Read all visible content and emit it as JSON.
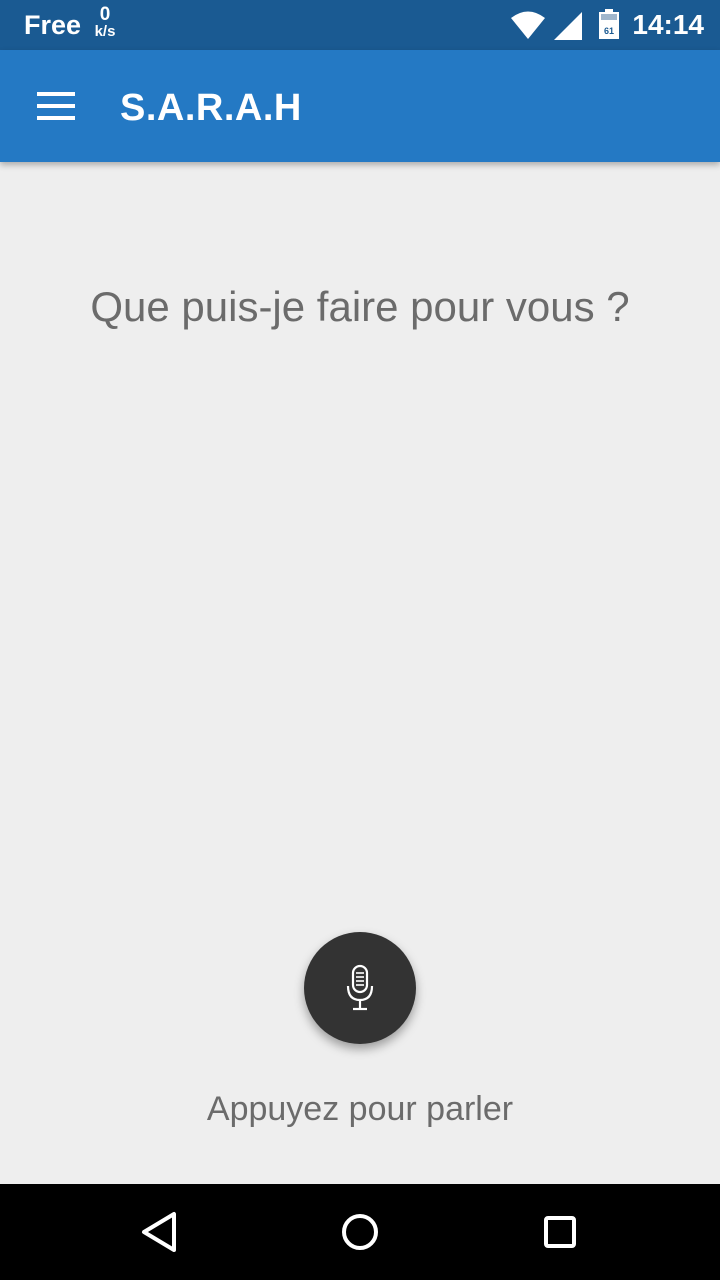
{
  "status_bar": {
    "carrier": "Free",
    "net_speed_value": "0",
    "net_speed_unit": "k/s",
    "battery_level": "61",
    "time": "14:14",
    "icons": [
      "wifi-icon",
      "cell-signal-icon",
      "battery-icon"
    ]
  },
  "app_bar": {
    "title": "S.A.R.A.H",
    "menu_icon": "hamburger-menu-icon"
  },
  "main": {
    "prompt": "Que puis-je faire pour vous ?",
    "mic_icon": "microphone-icon",
    "hint": "Appuyez pour parler"
  },
  "nav_bar": {
    "items": [
      "back-icon",
      "home-icon",
      "recents-icon"
    ]
  },
  "colors": {
    "status_bar": "#1a5a92",
    "app_bar": "#2479c4",
    "background": "#eeeeee",
    "text_secondary": "#6b6b6b",
    "mic_button": "#333333",
    "nav_bar": "#000000"
  }
}
